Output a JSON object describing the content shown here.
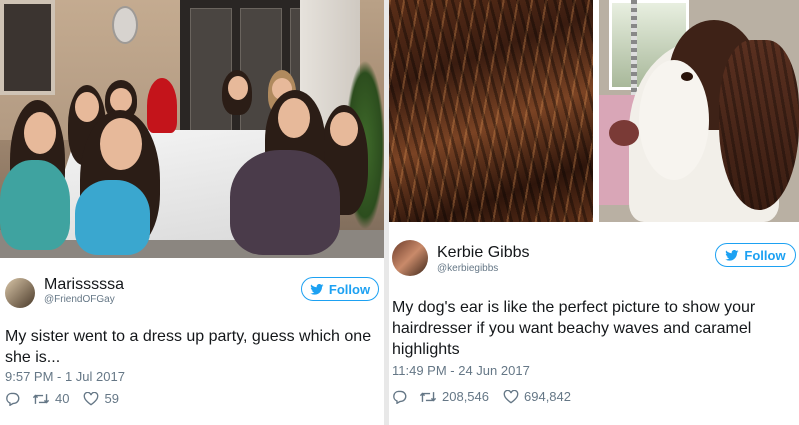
{
  "left_tweet": {
    "name": "Marisssssa",
    "handle": "@FriendOFGay",
    "follow_label": "Follow",
    "text_line1": "My sister went to a dress up party, guess which one",
    "text_line2": "she is...",
    "timestamp": "9:57 PM - 1 Jul 2017",
    "retweets": "40",
    "likes": "59"
  },
  "right_tweet": {
    "name": "Kerbie Gibbs",
    "handle": "@kerbiegibbs",
    "follow_label": "Follow",
    "text_line1": "My dog's ear is like the perfect picture to show your",
    "text_line2": "hairdresser if you want beachy waves and caramel",
    "text_line3": "highlights",
    "timestamp": "11:49 PM - 24 Jun 2017",
    "retweets": "208,546",
    "likes": "694,842"
  },
  "colors": {
    "twitter_blue": "#1da1f2",
    "meta_gray": "#657786",
    "text": "#14171a"
  },
  "icons": [
    "reply-icon",
    "retweet-icon",
    "like-icon",
    "twitter-bird-icon"
  ]
}
